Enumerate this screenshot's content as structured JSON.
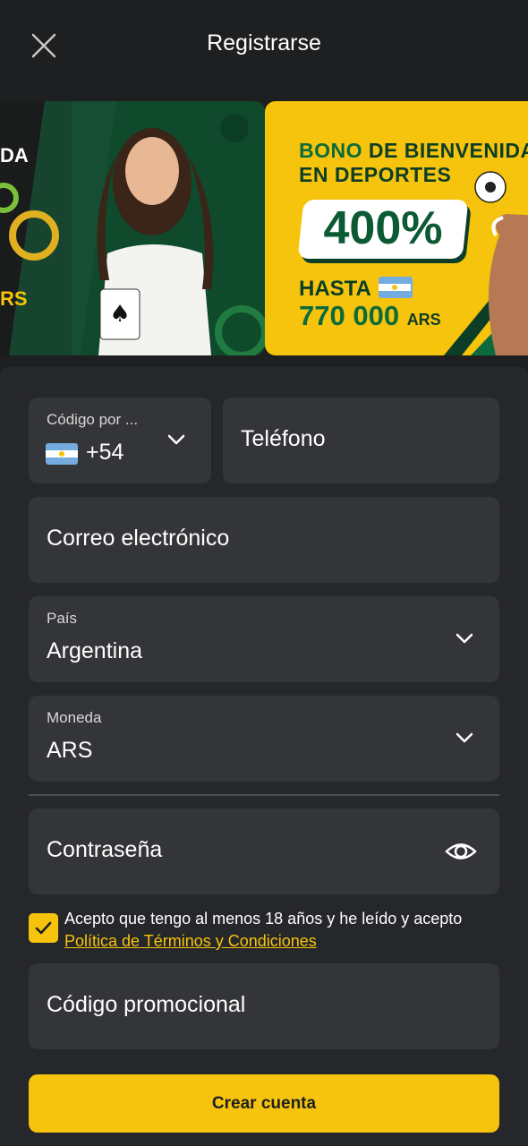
{
  "header": {
    "title": "Registrarse",
    "close_icon": "close-icon"
  },
  "banners": {
    "left": {
      "text_top": "DA",
      "text_bottom": "RS"
    },
    "right": {
      "line1_a": "BONO",
      "line1_b": "DE BIENVENIDA",
      "line2": "EN DEPORTES",
      "percent": "400%",
      "hasta": "HASTA",
      "amount": "770 000",
      "currency": "ARS"
    }
  },
  "form": {
    "phone_code": {
      "label": "Código por ...",
      "value": "+54"
    },
    "phone": {
      "placeholder": "Teléfono"
    },
    "email": {
      "placeholder": "Correo electrónico"
    },
    "country": {
      "label": "País",
      "value": "Argentina"
    },
    "currency": {
      "label": "Moneda",
      "value": "ARS"
    },
    "password": {
      "placeholder": "Contraseña"
    },
    "terms": {
      "checked": true,
      "text": "Acepto que tengo al menos 18 años y he leído y acepto ",
      "link": "Política de Términos y Condiciones"
    },
    "promo": {
      "placeholder": "Código promocional"
    },
    "submit_label": "Crear cuenta"
  },
  "colors": {
    "accent": "#f6c40c",
    "background": "#1e1f21",
    "field": "#343538",
    "banner_green": "#0c6b3c"
  }
}
